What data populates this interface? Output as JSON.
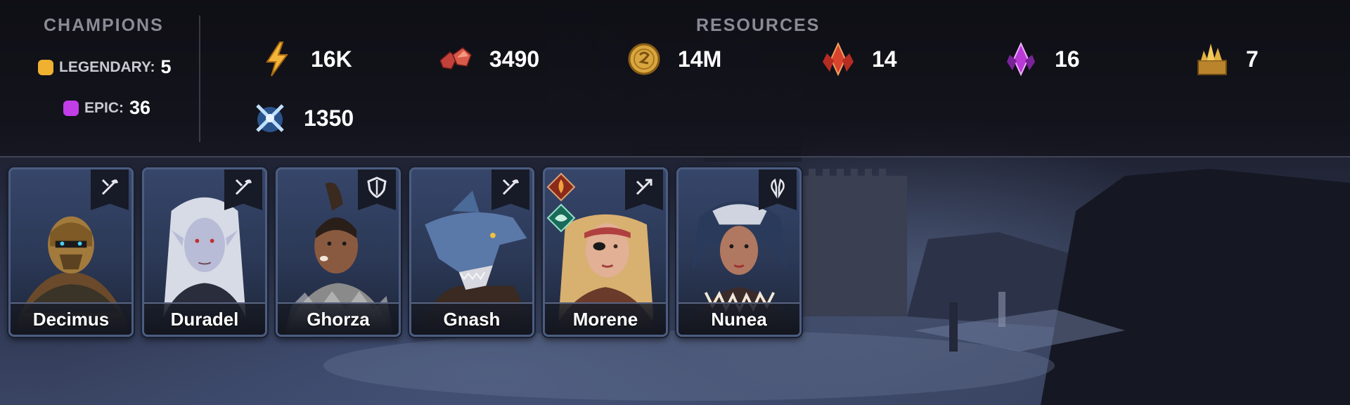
{
  "header": {
    "champions_title": "CHAMPIONS",
    "resources_title": "RESOURCES",
    "rarities": [
      {
        "label": "LEGENDARY:",
        "count": "5",
        "color": "#f0b030"
      },
      {
        "label": "EPIC:",
        "count": "36",
        "color": "#c23ee6"
      }
    ]
  },
  "resources": [
    {
      "icon": "energy-icon",
      "value": "16K"
    },
    {
      "icon": "gems-icon",
      "value": "3490"
    },
    {
      "icon": "silver-coin-icon",
      "value": "14M"
    },
    {
      "icon": "ancient-shard-icon",
      "value": "14"
    },
    {
      "icon": "void-shard-icon",
      "value": "16"
    },
    {
      "icon": "sacred-shard-icon",
      "value": "7"
    },
    {
      "icon": "arena-token-icon",
      "value": "1350"
    }
  ],
  "champions": [
    {
      "name": "Decimus",
      "role": "attack-role-icon",
      "affinity": []
    },
    {
      "name": "Duradel",
      "role": "attack-role-icon",
      "affinity": []
    },
    {
      "name": "Ghorza",
      "role": "defense-role-icon",
      "affinity": []
    },
    {
      "name": "Gnash",
      "role": "attack-role-icon",
      "affinity": []
    },
    {
      "name": "Morene",
      "role": "support-role-icon",
      "affinity": [
        "force-affinity-icon",
        "spirit-affinity-icon"
      ]
    },
    {
      "name": "Nunea",
      "role": "hp-role-icon",
      "affinity": []
    }
  ]
}
